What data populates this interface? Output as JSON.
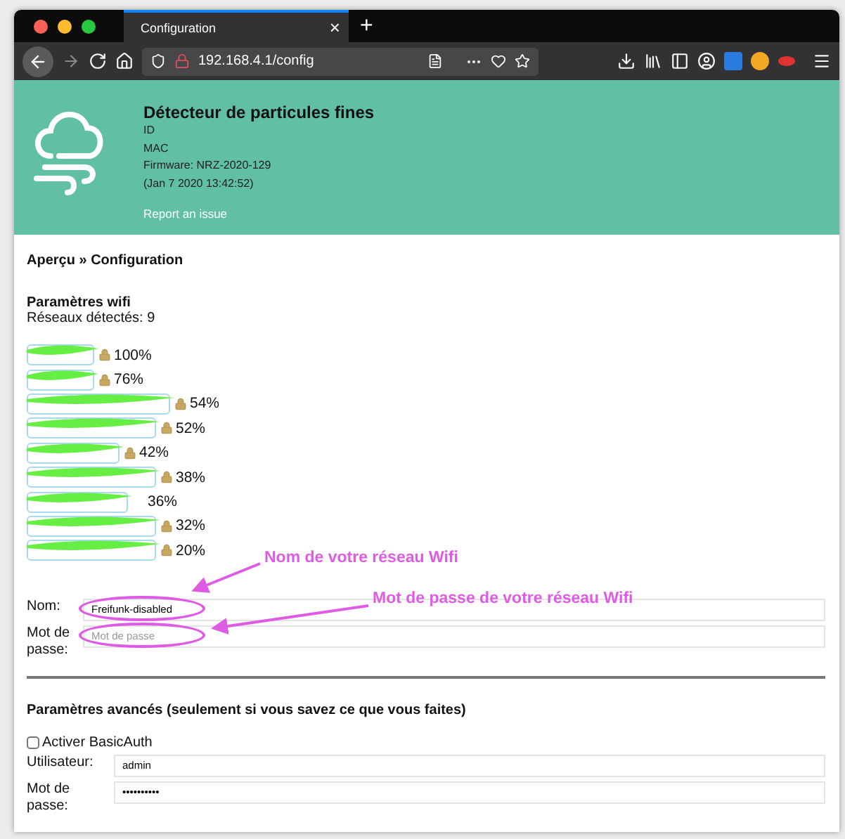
{
  "browser": {
    "tabs": [
      {
        "label": "Configuration",
        "selected": true
      }
    ],
    "close_tab": "×",
    "new_tab": "+",
    "url": "192.168.4.1/config"
  },
  "header": {
    "title": "Détecteur de particules fines",
    "lines": [
      "ID",
      "MAC",
      "Firmware: NRZ-2020-129",
      "(Jan 7 2020 13:42:52)"
    ],
    "link": "Report an issue"
  },
  "breadcrumb": "Aperçu » Configuration",
  "wifi": {
    "title": "Paramètres wifi",
    "count": "Réseaux détectés: 9",
    "networks": [
      {
        "signal": "100%",
        "locked": true
      },
      {
        "signal": "76%",
        "locked": true
      },
      {
        "signal": "54%",
        "locked": true
      },
      {
        "signal": "52%",
        "locked": true
      },
      {
        "signal": "42%",
        "locked": true
      },
      {
        "signal": "38%",
        "locked": true
      },
      {
        "signal": "36%",
        "locked": false
      },
      {
        "signal": "32%",
        "locked": true
      },
      {
        "signal": "20%",
        "locked": true
      }
    ],
    "fields": [
      {
        "label": "Nom:",
        "value": "Freifunk-disabled",
        "circled": true
      },
      {
        "label": "Mot de passe:",
        "placeholder": "Mot de passe",
        "circled": true
      }
    ]
  },
  "annotations": [
    "Nom de votre réseau Wifi",
    "Mot de passe de votre réseau Wifi"
  ],
  "advanced": {
    "title": "Paramètres avancés (seulement si vous savez ce que vous faites)",
    "checkbox": {
      "label": "Activer BasicAuth",
      "checked": false
    },
    "fields": [
      {
        "label": "Utilisateur:",
        "value": "admin"
      },
      {
        "label": "Mot de passe:",
        "value": "••••••••••"
      }
    ]
  }
}
